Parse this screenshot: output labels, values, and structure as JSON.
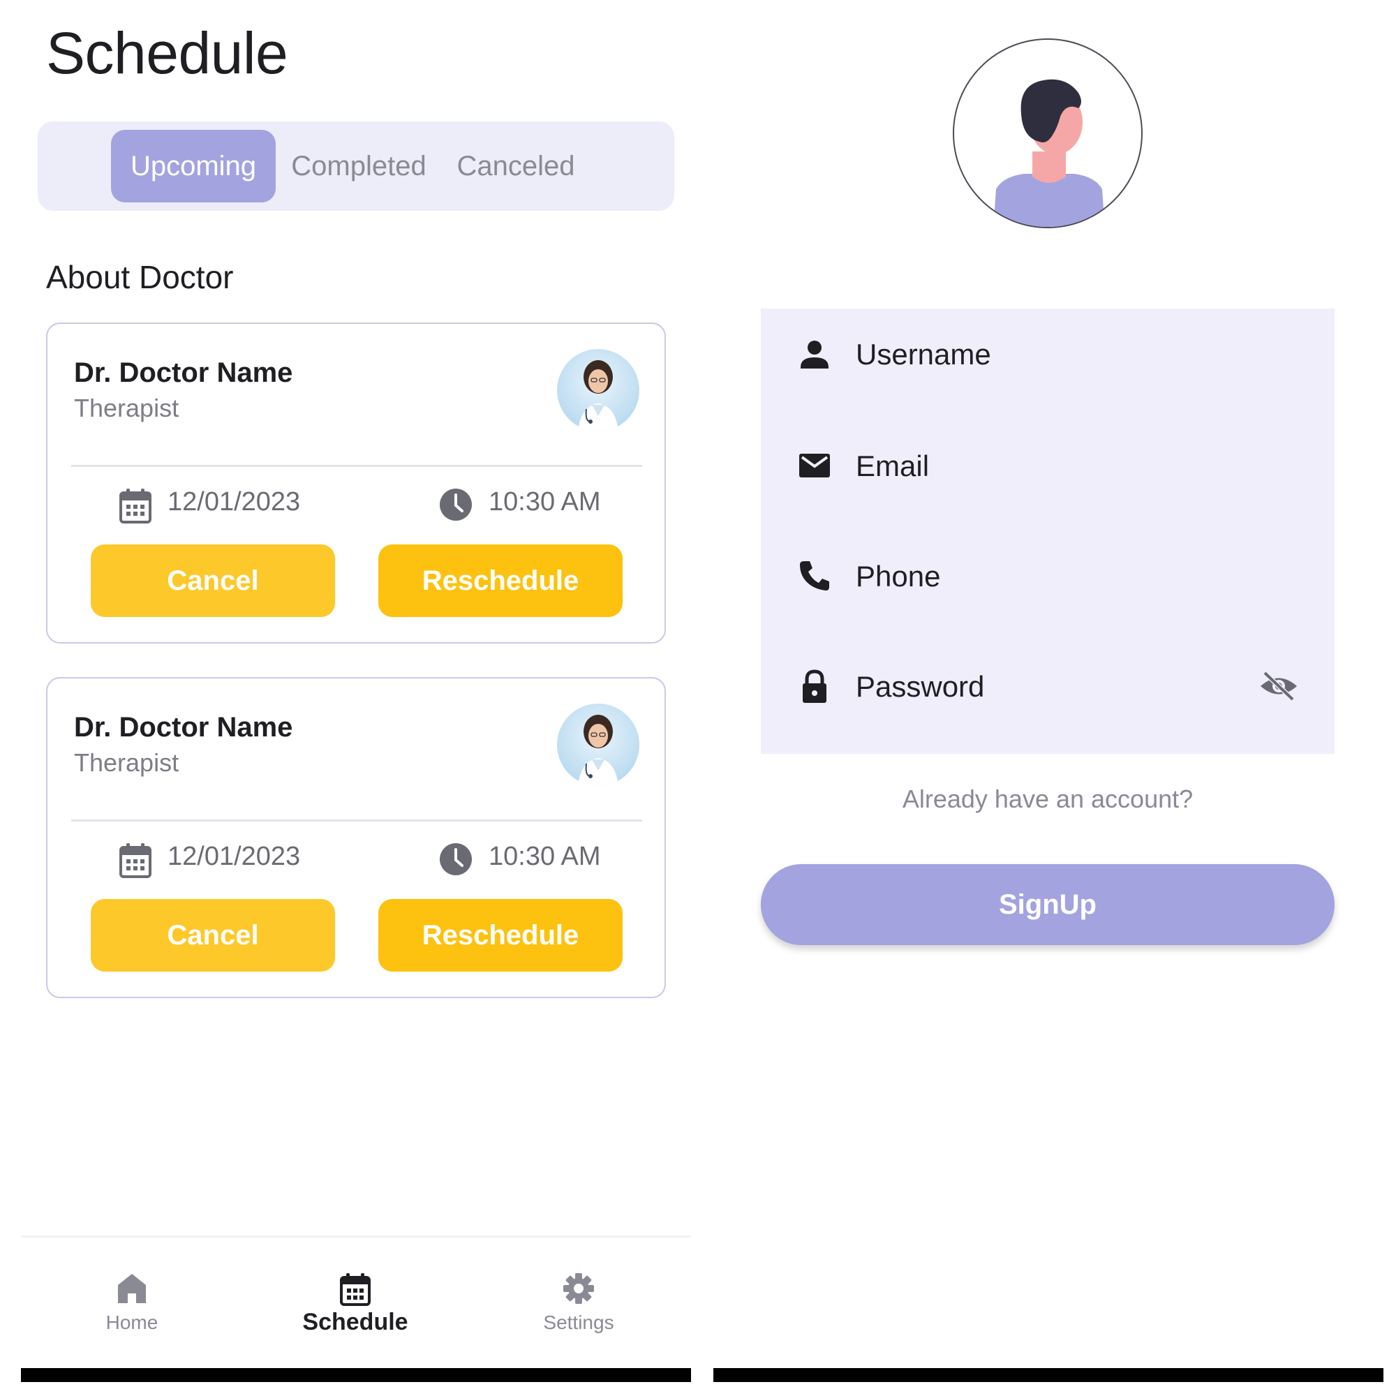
{
  "schedule": {
    "title": "Schedule",
    "tabs": [
      {
        "label": "Upcoming",
        "active": true
      },
      {
        "label": "Completed",
        "active": false
      },
      {
        "label": "Canceled",
        "active": false
      }
    ],
    "section_title": "About Doctor",
    "appointments": [
      {
        "doctor_name": "Dr. Doctor Name",
        "role": "Therapist",
        "date": "12/01/2023",
        "time": "10:30 AM",
        "cancel_label": "Cancel",
        "reschedule_label": "Reschedule"
      },
      {
        "doctor_name": "Dr. Doctor Name",
        "role": "Therapist",
        "date": "12/01/2023",
        "time": "10:30 AM",
        "cancel_label": "Cancel",
        "reschedule_label": "Reschedule"
      }
    ],
    "bottom_nav": [
      {
        "label": "Home",
        "icon": "home-icon",
        "active": false
      },
      {
        "label": "Schedule",
        "icon": "calendar-icon",
        "active": true
      },
      {
        "label": "Settings",
        "icon": "gear-icon",
        "active": false
      }
    ]
  },
  "signup": {
    "fields": [
      {
        "label": "Username",
        "icon": "person-icon"
      },
      {
        "label": "Email",
        "icon": "mail-icon"
      },
      {
        "label": "Phone",
        "icon": "phone-icon"
      },
      {
        "label": "Password",
        "icon": "lock-icon",
        "toggle_icon": "eye-off-icon"
      }
    ],
    "login_prompt": "Already have an account?",
    "signup_label": "SignUp"
  },
  "colors": {
    "accent": "#a3a3e0",
    "accent_light": "#ededf9",
    "button_yellow": "#fcc20f",
    "text_dark": "#1f1f23",
    "text_muted": "#8a8a95"
  }
}
